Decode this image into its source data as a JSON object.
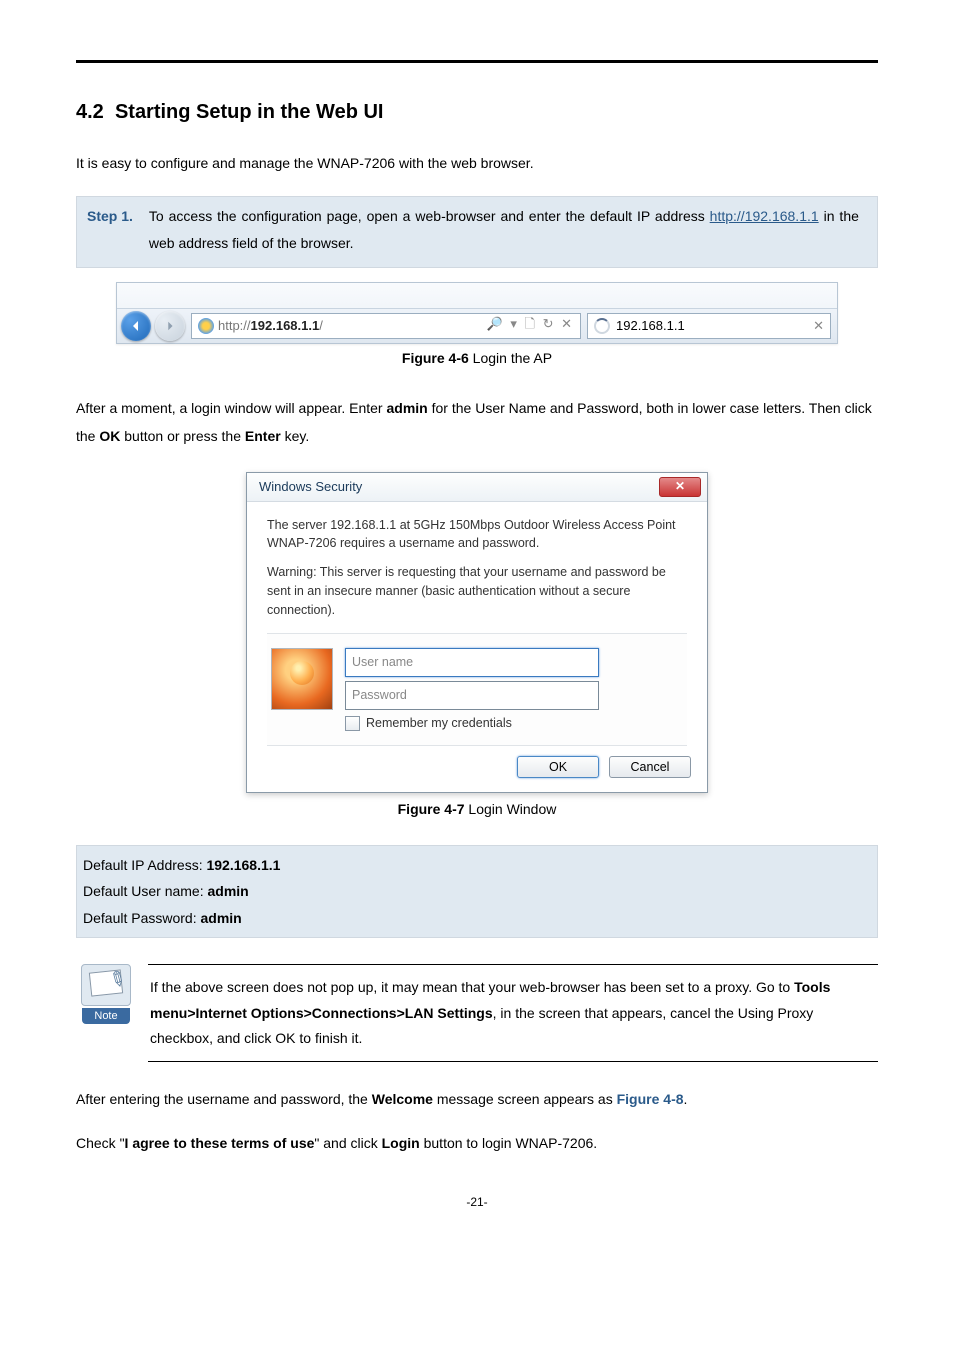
{
  "section": {
    "number": "4.2",
    "title": "Starting Setup in the Web UI"
  },
  "intro": "It is easy to configure and manage the WNAP-7206 with the web browser.",
  "step1": {
    "label": "Step 1.",
    "text_before": "To access the configuration page, open a web-browser and enter the default IP address ",
    "url": "http://192.168.1.1",
    "text_after": " in the web address field of the browser."
  },
  "browser": {
    "url_prefix": "http://",
    "url_bold": "192.168.1.1",
    "url_suffix": "/",
    "tab_label": "192.168.1.1",
    "search_glyph": "🔎",
    "tools_glyphs": "▾  🗋 ↻ ✕"
  },
  "figure6": {
    "num": "Figure 4-6",
    "caption": " Login the AP"
  },
  "after_moment": {
    "p1a": "After a moment, a login window will appear. Enter ",
    "admin": "admin",
    "p1b": " for the User Name and Password, both in lower case letters. Then click the ",
    "ok": "OK",
    "p1c": " button or press the ",
    "enter": "Enter",
    "p1d": " key."
  },
  "dialog": {
    "title": "Windows Security",
    "close": "✕",
    "line1": "The server 192.168.1.1 at 5GHz 150Mbps Outdoor Wireless  Access Point WNAP-7206 requires a username and password.",
    "line2": "Warning: This server is requesting that your username and password be sent in an insecure manner (basic authentication without a secure connection).",
    "username_placeholder": "User name",
    "password_placeholder": "Password",
    "remember": "Remember my credentials",
    "ok_btn": "OK",
    "cancel_btn": "Cancel"
  },
  "figure7": {
    "num": "Figure 4-7",
    "caption": " Login Window"
  },
  "defaults": {
    "ip_label": "Default IP Address: ",
    "ip_value": "192.168.1.1",
    "user_label": "Default User name: ",
    "user_value": "admin",
    "pass_label": "Default Password: ",
    "pass_value": "admin"
  },
  "note": {
    "badge": "Note",
    "t1": "If the above screen does not pop up, it may mean that your web-browser has been set to a proxy. Go to ",
    "bold": "Tools menu>Internet Options>Connections>LAN Settings",
    "t2": ", in the screen that appears, cancel the Using Proxy checkbox, and click OK to finish it."
  },
  "after_login": {
    "t1": "After entering the username and password, the ",
    "welcome": "Welcome",
    "t2": " message screen appears as ",
    "figref": "Figure 4-8",
    "t3": "."
  },
  "check_line": {
    "t1": "Check \"",
    "agree": "I agree to these terms of use",
    "t2": "\" and click ",
    "login": "Login",
    "t3": " button to login WNAP-7206."
  },
  "page_number": "-21-"
}
